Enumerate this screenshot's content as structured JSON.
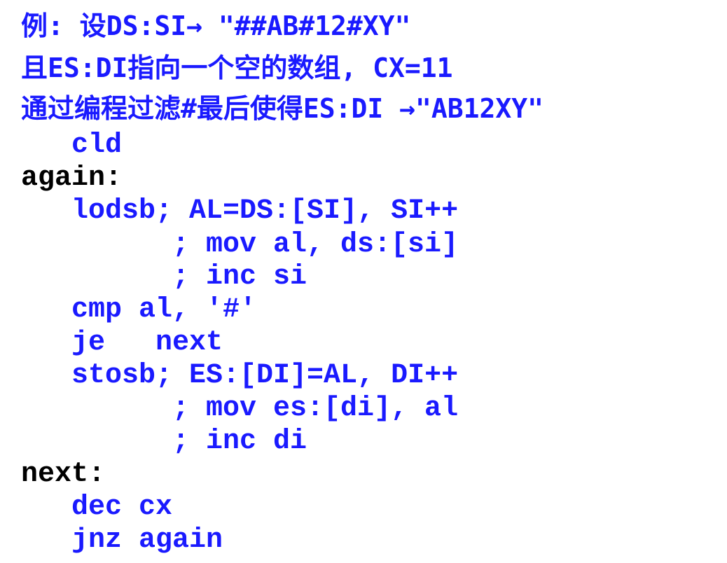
{
  "colors": {
    "code_text": "#1a1aff",
    "label_text": "#000000",
    "background": "#ffffff"
  },
  "intro": {
    "line1": "例: 设DS:SI→ \"##AB#12#XY\"",
    "line2": "且ES:DI指向一个空的数组, CX=11",
    "line3": "通过编程过滤#最后使得ES:DI →\"AB12XY\""
  },
  "code": {
    "cld": "cld",
    "label_again": "again:",
    "lodsb": "lodsb; AL=DS:[SI], SI++",
    "lodsb_comment1": "; mov al, ds:[si]",
    "lodsb_comment2": "; inc si",
    "cmp": "cmp al, '#'",
    "je": "je   next",
    "stosb": "stosb; ES:[DI]=AL, DI++",
    "stosb_comment1": "; mov es:[di], al",
    "stosb_comment2": "; inc di",
    "label_next": "next:",
    "dec": "dec cx",
    "jnz": "jnz again"
  }
}
